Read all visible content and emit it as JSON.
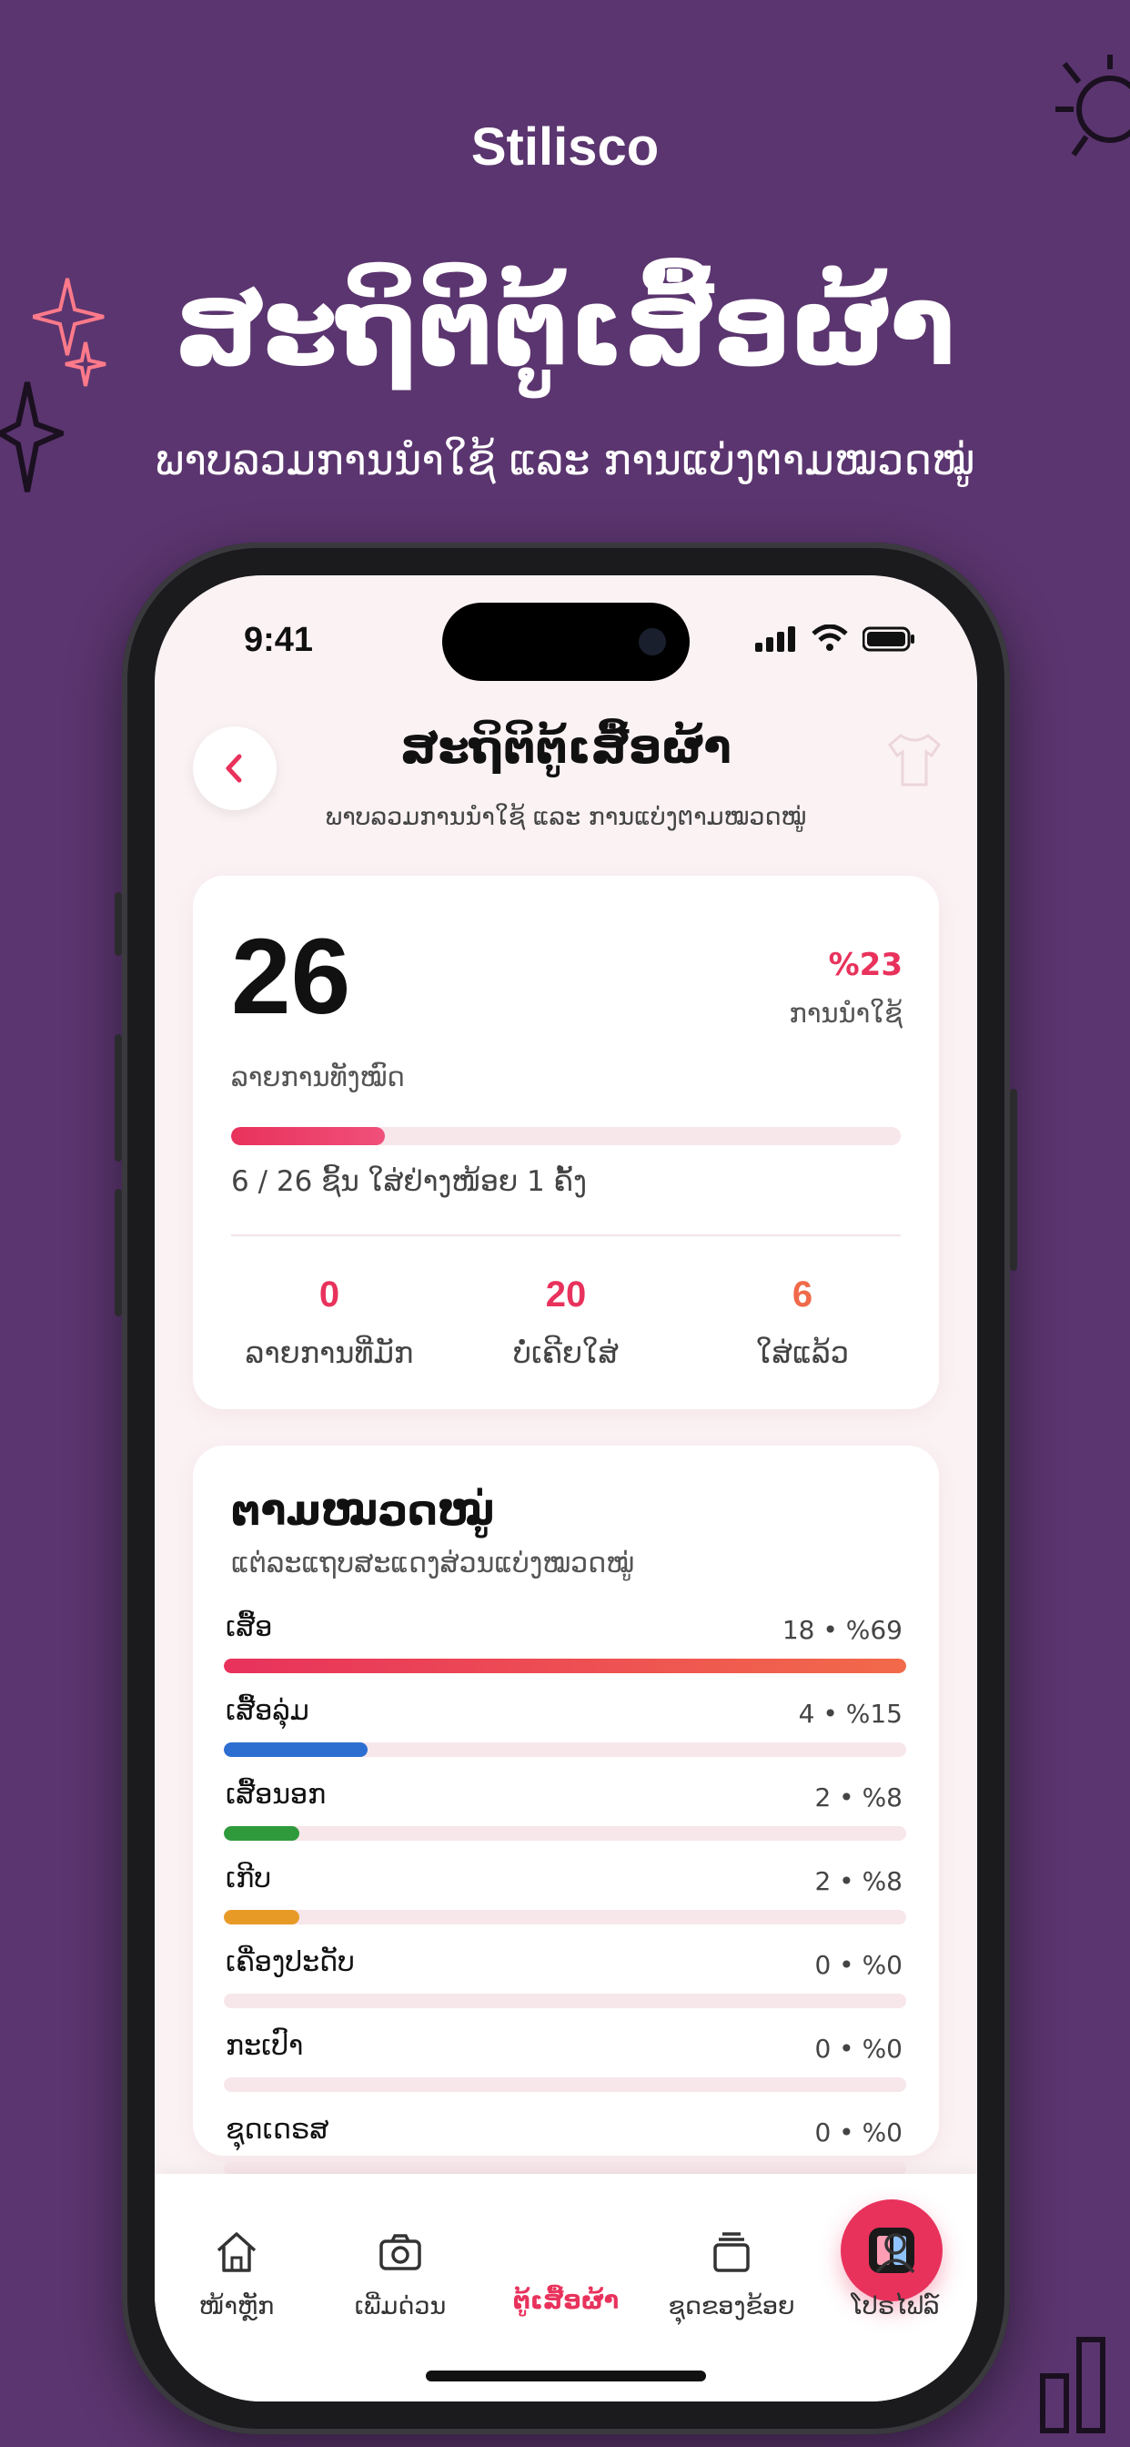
{
  "brand": "Stilisco",
  "hero": {
    "title": "ສະຖິຕິຕູ້ເສື້ອຜ້າ",
    "subtitle": "ພາບລວມການນຳໃຊ້ ແລະ ການແບ່ງຕາມໝວດໝູ່"
  },
  "status_bar": {
    "time": "9:41"
  },
  "header": {
    "title": "ສະຖິຕິຕູ້ເສື້ອຜ້າ",
    "subtitle": "ພາບລວມການນຳໃຊ້ ແລະ ການແບ່ງຕາມໝວດໝູ່"
  },
  "summary": {
    "total": "26",
    "total_label": "ລາຍການທັງໝົດ",
    "usage_pct": "%23",
    "usage_label": "ການນຳໃຊ້",
    "progress_fraction": 0.23,
    "progress_text": "6 / 26  ຊິ້ນ  ໃສ່ຢ່າງໜ້ອຍ 1 ຄັ້ງ",
    "stats": [
      {
        "value": "0",
        "label": "ລາຍການທີ່ມັກ"
      },
      {
        "value": "20",
        "label": "ບໍ່ເຄີຍໃສ່"
      },
      {
        "value": "6",
        "label": "ໃສ່ແລ້ວ"
      }
    ]
  },
  "categories": {
    "title": "ຕາມໝວດໝູ່",
    "subtitle": "ແຕ່ລະແຖບສະແດງສ່ວນແບ່ງໝວດໝູ່",
    "items": [
      {
        "name": "ເສື້ອ",
        "value": "18 • %69",
        "fraction": 1.0,
        "color": "#e8325c"
      },
      {
        "name": "ເສື້ອລຸ່ມ",
        "value": "4 • %15",
        "fraction": 0.21,
        "color": "#2d6fd1"
      },
      {
        "name": "ເສື້ອນອກ",
        "value": "2 • %8",
        "fraction": 0.11,
        "color": "#2f9a3c"
      },
      {
        "name": "ເກີບ",
        "value": "2 • %8",
        "fraction": 0.11,
        "color": "#e89a26"
      },
      {
        "name": "ເຄື່ອງປະດັບ",
        "value": "0 • %0",
        "fraction": 0,
        "color": "#e8325c"
      },
      {
        "name": "ກະເປົາ",
        "value": "0 • %0",
        "fraction": 0,
        "color": "#e8325c"
      },
      {
        "name": "ຊຸດເດຣສ",
        "value": "0 • %0",
        "fraction": 0,
        "color": "#e8325c"
      }
    ]
  },
  "tabbar": {
    "tabs": [
      {
        "label": "ໜ້າຫຼັກ",
        "icon": "home-icon"
      },
      {
        "label": "ເພີ່ມດ່ວນ",
        "icon": "camera-icon"
      },
      {
        "label": "ຕູ້ເສື້ອຜ້າ",
        "icon": "wardrobe-icon",
        "active": true
      },
      {
        "label": "ຊຸດຂອງຂ້ອຍ",
        "icon": "stack-icon"
      },
      {
        "label": "ໂປຣໄຟລ໌",
        "icon": "user-icon"
      }
    ]
  },
  "colors": {
    "accent": "#e8325c",
    "background": "#5b356f"
  }
}
